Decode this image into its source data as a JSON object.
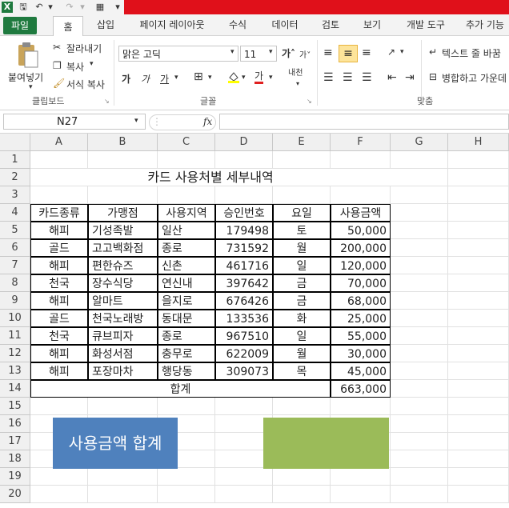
{
  "quick_access": {
    "icons": [
      "excel-logo-icon",
      "save-icon",
      "undo-icon",
      "redo-icon",
      "calculator-icon",
      "customize-icon"
    ]
  },
  "tabs": [
    "파일",
    "홈",
    "삽입",
    "페이지 레이아웃",
    "수식",
    "데이터",
    "검토",
    "보기",
    "개발 도구",
    "추가 기능"
  ],
  "ribbon": {
    "clipboard": {
      "paste": "붙여넣기",
      "cut": "잘라내기",
      "copy": "복사",
      "format_painter": "서식 복사",
      "group_label": "클립보드"
    },
    "font": {
      "font_name": "맑은 고딕",
      "font_size": "11",
      "group_label": "글꼴",
      "bold": "가",
      "italic": "가",
      "underline": "가",
      "phonetic": "내천"
    },
    "alignment": {
      "wrap_text": "텍스트 줄 바꿈",
      "merge_center": "병합하고 가운데",
      "group_label": "맞춤"
    }
  },
  "formula_bar": {
    "name_box": "N27",
    "fx": "fx",
    "formula": ""
  },
  "sheet": {
    "columns": [
      "A",
      "B",
      "C",
      "D",
      "E",
      "F",
      "G",
      "H"
    ],
    "rows": [
      "1",
      "2",
      "3",
      "4",
      "5",
      "6",
      "7",
      "8",
      "9",
      "10",
      "11",
      "12",
      "13",
      "14",
      "15",
      "16",
      "17",
      "18",
      "19",
      "20"
    ],
    "title": "카드 사용처별 세부내역",
    "headers": [
      "카드종류",
      "가맹점",
      "사용지역",
      "승인번호",
      "요일",
      "사용금액"
    ],
    "data": [
      [
        "해피",
        "기성족발",
        "일산",
        "179498",
        "토",
        "50,000"
      ],
      [
        "골드",
        "고고백화점",
        "종로",
        "731592",
        "월",
        "200,000"
      ],
      [
        "해피",
        "편한슈즈",
        "신촌",
        "461716",
        "일",
        "120,000"
      ],
      [
        "천국",
        "장수식당",
        "연신내",
        "397642",
        "금",
        "70,000"
      ],
      [
        "해피",
        "알마트",
        "을지로",
        "676426",
        "금",
        "68,000"
      ],
      [
        "골드",
        "천국노래방",
        "동대문",
        "133536",
        "화",
        "25,000"
      ],
      [
        "천국",
        "큐브피자",
        "종로",
        "967510",
        "일",
        "55,000"
      ],
      [
        "해피",
        "화성서점",
        "충무로",
        "622009",
        "월",
        "30,000"
      ],
      [
        "해피",
        "포장마차",
        "행당동",
        "309073",
        "목",
        "45,000"
      ]
    ],
    "total_label": "합계",
    "total_value": "663,000",
    "shape_blue_text": "사용금액 합계",
    "shape_green_text": ""
  },
  "colors": {
    "file_tab": "#1f7a3f",
    "title_bar": "#e0101a",
    "shape_blue": "#4f81bd",
    "shape_green": "#9bbb59"
  }
}
